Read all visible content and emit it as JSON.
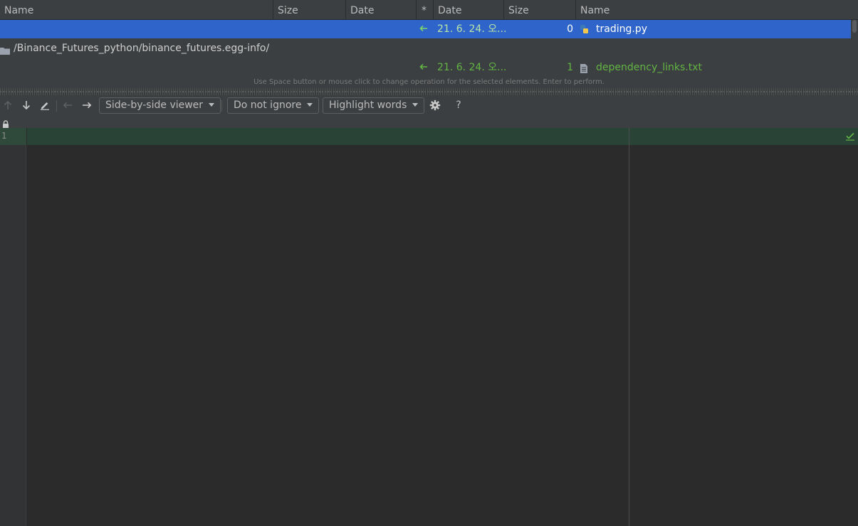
{
  "table": {
    "headers": [
      "Name",
      "Size",
      "Date",
      "*",
      "Date",
      "Size",
      "Name"
    ],
    "rows": [
      {
        "right_date": "21. 6. 24. 오...",
        "right_size": "0",
        "right_name": "trading.py",
        "selected": true
      },
      {
        "path": "/Binance_Futures_python/binance_futures.egg-info/"
      },
      {
        "right_date": "21. 6. 24. 오...",
        "right_size": "1",
        "right_name": "dependency_links.txt",
        "selected": false
      }
    ],
    "hint": "Use Space button or mouse click to change operation for the selected elements. Enter to perform."
  },
  "toolbar": {
    "viewer": "Side-by-side viewer",
    "ignore": "Do not ignore",
    "highlight": "Highlight words",
    "help": "?"
  },
  "editor": {
    "line_number": "1"
  },
  "colors": {
    "selection": "#2f65ca",
    "added": "#62b543",
    "added_bg": "#294436"
  }
}
